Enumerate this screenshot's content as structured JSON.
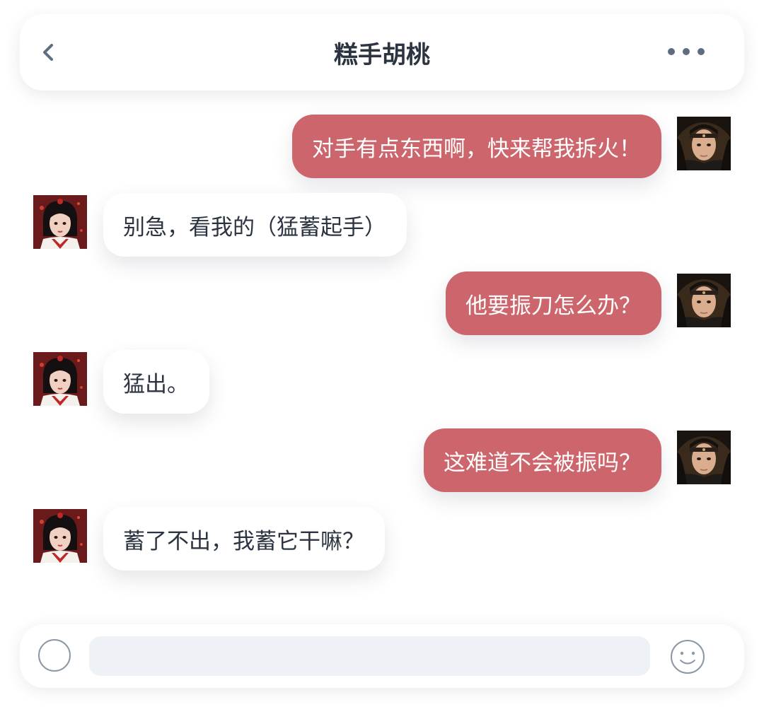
{
  "header": {
    "title": "糕手胡桃",
    "back_icon": "chevron-left-icon",
    "more_icon": "more-horizontal-icon"
  },
  "colors": {
    "outgoing_bubble": "#cd666c",
    "incoming_bubble": "#ffffff",
    "text_dark": "#2b3440",
    "icon_gray": "#5e6e80",
    "input_bg": "#eef2f6"
  },
  "messages": [
    {
      "side": "out",
      "text": "对手有点东西啊，快来帮我拆火！",
      "avatar": "male-warrior-avatar"
    },
    {
      "side": "in",
      "text": "别急，看我的（猛蓄起手）",
      "avatar": "female-fighter-avatar"
    },
    {
      "side": "out",
      "text": "他要振刀怎么办？",
      "avatar": "male-warrior-avatar"
    },
    {
      "side": "in",
      "text": "猛出。",
      "avatar": "female-fighter-avatar"
    },
    {
      "side": "out",
      "text": "这难道不会被振吗？",
      "avatar": "male-warrior-avatar"
    },
    {
      "side": "in",
      "text": "蓄了不出，我蓄它干嘛？",
      "avatar": "female-fighter-avatar"
    }
  ],
  "input_bar": {
    "value": "",
    "placeholder": "",
    "voice_icon": "circle-icon",
    "emoji_icon": "smiley-icon"
  }
}
